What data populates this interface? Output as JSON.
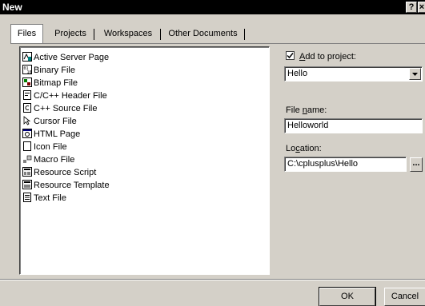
{
  "window": {
    "title": "New",
    "help_btn": "?",
    "close_btn": "×"
  },
  "tabs": [
    {
      "label": "Files"
    },
    {
      "label": "Projects"
    },
    {
      "label": "Workspaces"
    },
    {
      "label": "Other Documents"
    }
  ],
  "file_types": [
    {
      "label": "Active Server Page",
      "icon": "asp-page-icon"
    },
    {
      "label": "Binary File",
      "icon": "binary-file-icon"
    },
    {
      "label": "Bitmap File",
      "icon": "bitmap-file-icon"
    },
    {
      "label": "C/C++ Header File",
      "icon": "header-file-icon"
    },
    {
      "label": "C++ Source File",
      "icon": "cpp-source-file-icon"
    },
    {
      "label": "Cursor File",
      "icon": "cursor-file-icon"
    },
    {
      "label": "HTML Page",
      "icon": "html-page-icon"
    },
    {
      "label": "Icon File",
      "icon": "icon-file-icon"
    },
    {
      "label": "Macro File",
      "icon": "macro-file-icon"
    },
    {
      "label": "Resource Script",
      "icon": "resource-script-icon"
    },
    {
      "label": "Resource Template",
      "icon": "resource-template-icon"
    },
    {
      "label": "Text File",
      "icon": "text-file-icon"
    }
  ],
  "add_to_project": {
    "checked": true,
    "label_pre": "",
    "label_accel": "A",
    "label_post": "dd to project:"
  },
  "project_combo": {
    "value": "Hello"
  },
  "file_name": {
    "label_pre": "File ",
    "label_accel": "n",
    "label_post": "ame:",
    "value": "Helloworld"
  },
  "location": {
    "label_pre": "Lo",
    "label_accel": "c",
    "label_post": "ation:",
    "value": "C:\\cplusplus\\Hello",
    "browse_label": "..."
  },
  "buttons": {
    "ok": "OK",
    "cancel": "Cancel"
  }
}
